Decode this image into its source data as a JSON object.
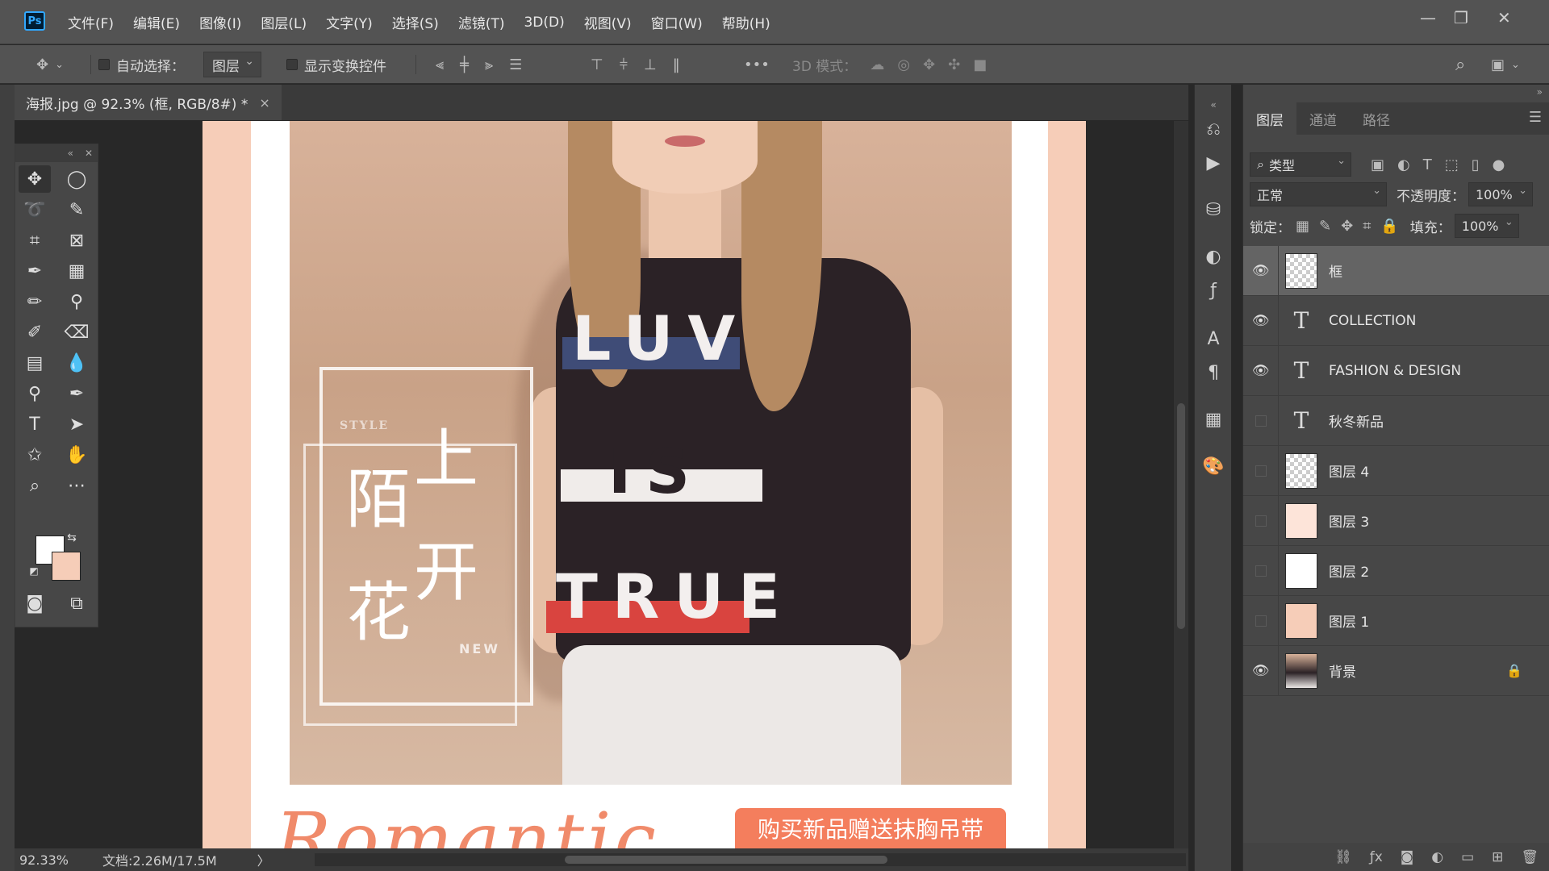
{
  "app": {
    "logo": "Ps"
  },
  "menu": [
    "文件(F)",
    "编辑(E)",
    "图像(I)",
    "图层(L)",
    "文字(Y)",
    "选择(S)",
    "滤镜(T)",
    "3D(D)",
    "视图(V)",
    "窗口(W)",
    "帮助(H)"
  ],
  "window_controls": {
    "minimize": "—",
    "restore": "❐",
    "close": "✕"
  },
  "options": {
    "auto_select_label": "自动选择：",
    "auto_select_value": "图层",
    "show_transform_label": "显示变换控件",
    "more": "•••",
    "mode_3d_label": "3D 模式："
  },
  "document": {
    "tab_title": "海报.jpg @ 92.3% (框, RGB/8#) *",
    "close": "×"
  },
  "poster": {
    "style_label": "STYLE",
    "cn_chars": [
      "陌",
      "上",
      "花",
      "开"
    ],
    "new_label": "NEW",
    "shirt_words": [
      "LUV",
      "IS",
      "TRUE"
    ],
    "romantic": "Romantic",
    "promo": "购买新品赠送抹胸吊带"
  },
  "status": {
    "zoom": "92.33%",
    "doc": "文档:2.26M/17.5M",
    "arrow": "〉"
  },
  "layers_panel": {
    "tabs": [
      "图层",
      "通道",
      "路径"
    ],
    "filter_label": "类型",
    "blend_mode": "正常",
    "opacity_label": "不透明度：",
    "opacity_value": "100%",
    "lock_label": "锁定：",
    "fill_label": "填充：",
    "fill_value": "100%",
    "layers": [
      {
        "name": "框",
        "visible": true,
        "kind": "raster",
        "thumb": "checker",
        "selected": true
      },
      {
        "name": "COLLECTION",
        "visible": true,
        "kind": "text",
        "thumb": "text"
      },
      {
        "name": "FASHION & DESIGN",
        "visible": true,
        "kind": "text",
        "thumb": "text"
      },
      {
        "name": "秋冬新品",
        "visible": false,
        "kind": "text",
        "thumb": "text"
      },
      {
        "name": "图层 4",
        "visible": false,
        "kind": "raster",
        "thumb": "checker"
      },
      {
        "name": "图层 3",
        "visible": false,
        "kind": "raster",
        "thumb": "#fde4d9"
      },
      {
        "name": "图层 2",
        "visible": false,
        "kind": "raster",
        "thumb": "#ffffff"
      },
      {
        "name": "图层 1",
        "visible": false,
        "kind": "raster",
        "thumb": "#f6cdb8"
      },
      {
        "name": "背景",
        "visible": true,
        "kind": "background",
        "thumb": "photo",
        "locked": true
      }
    ]
  },
  "colors": {
    "foreground": "#ffffff",
    "background": "#f6cdb8",
    "accent": "#f47e5d"
  }
}
